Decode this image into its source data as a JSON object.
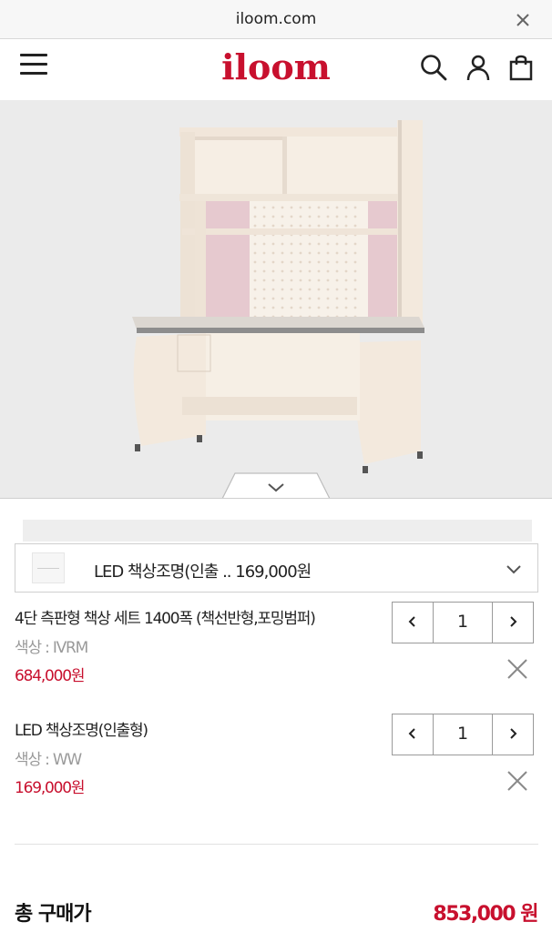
{
  "browser": {
    "url": "iloom.com"
  },
  "header": {
    "logo": "iloom",
    "icons": [
      "menu-icon",
      "search-icon",
      "user-icon",
      "shopping-bag-icon"
    ]
  },
  "options": {
    "selected_label": "LED 책상조명(인출 .. 169,000원"
  },
  "cart": {
    "items": [
      {
        "name": "4단 측판형 책상 세트 1400폭 (책선반형,포밍범퍼)",
        "color": "색상 : IVRM",
        "price": "684,000원",
        "quantity": "1"
      },
      {
        "name": "LED 책상조명(인출형)",
        "color": "색상 : WW",
        "price": "169,000원",
        "quantity": "1"
      }
    ]
  },
  "summary": {
    "total_label": "총 구매가",
    "total_value": "853,000 원"
  },
  "colors": {
    "brand": "#c8102e",
    "hero_bg": "#ebebeb",
    "desk_cream": "#f3e9dd",
    "desk_pink": "#e6c9cf"
  }
}
